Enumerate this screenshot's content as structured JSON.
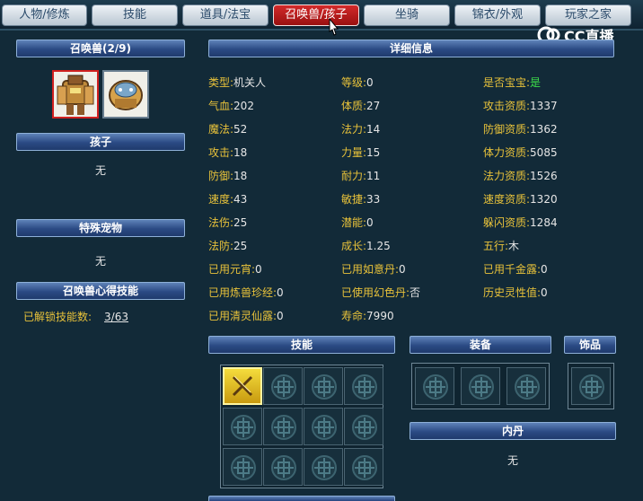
{
  "tabs": [
    {
      "label": "人物/修炼"
    },
    {
      "label": "技能"
    },
    {
      "label": "道具/法宝"
    },
    {
      "label": "召唤兽/孩子"
    },
    {
      "label": "坐骑"
    },
    {
      "label": "锦衣/外观"
    },
    {
      "label": "玩家之家"
    }
  ],
  "active_tab": "召唤兽/孩子",
  "logo": {
    "text": "CC直播"
  },
  "left": {
    "summon_header": "召唤兽(2/9)",
    "child_header": "孩子",
    "child_value": "无",
    "special_pet_header": "特殊宠物",
    "special_pet_value": "无",
    "heart_skill_header": "召唤兽心得技能",
    "unlocked_label": "已解锁技能数:",
    "unlocked_value": "3/63"
  },
  "detail": {
    "header": "详细信息",
    "rows": [
      [
        {
          "k": "类型:",
          "v": "机关人"
        },
        {
          "k": "等级:",
          "v": "0"
        },
        {
          "k": "是否宝宝:",
          "v": "是"
        }
      ],
      [
        {
          "k": "气血:",
          "v": "202"
        },
        {
          "k": "体质:",
          "v": "27"
        },
        {
          "k": "攻击资质:",
          "v": "1337"
        }
      ],
      [
        {
          "k": "魔法:",
          "v": "52"
        },
        {
          "k": "法力:",
          "v": "14"
        },
        {
          "k": "防御资质:",
          "v": "1362"
        }
      ],
      [
        {
          "k": "攻击:",
          "v": "18"
        },
        {
          "k": "力量:",
          "v": "15"
        },
        {
          "k": "体力资质:",
          "v": "5085"
        }
      ],
      [
        {
          "k": "防御:",
          "v": "18"
        },
        {
          "k": "耐力:",
          "v": "11"
        },
        {
          "k": "法力资质:",
          "v": "1526"
        }
      ],
      [
        {
          "k": "速度:",
          "v": "43"
        },
        {
          "k": "敏捷:",
          "v": "33"
        },
        {
          "k": "速度资质:",
          "v": "1320"
        }
      ],
      [
        {
          "k": "法伤:",
          "v": "25"
        },
        {
          "k": "潜能:",
          "v": "0"
        },
        {
          "k": "躲闪资质:",
          "v": "1284"
        }
      ],
      [
        {
          "k": "法防:",
          "v": "25"
        },
        {
          "k": "成长:",
          "v": "1.25"
        },
        {
          "k": "五行:",
          "v": "木"
        }
      ],
      [
        {
          "k": "已用元宵:",
          "v": "0"
        },
        {
          "k": "已用如意丹:",
          "v": "0"
        },
        {
          "k": "已用千金露:",
          "v": "0"
        }
      ],
      [
        {
          "k": "已用炼兽珍经:",
          "v": "0"
        },
        {
          "k": "已使用幻色丹:",
          "v": "否"
        },
        {
          "k": "历史灵性值:",
          "v": "0"
        }
      ],
      [
        {
          "k": "已用清灵仙露:",
          "v": "0"
        },
        {
          "k": "寿命:",
          "v": "7990"
        },
        {
          "k": "",
          "v": ""
        }
      ]
    ]
  },
  "skills_header": "技能",
  "equipment_header": "装备",
  "ornament_header": "饰品",
  "neidan_header": "内丹",
  "neidan_value": "无",
  "colors": {
    "label": "#e8c23a",
    "value": "#e6e6e6",
    "yes": "#3ee04a",
    "active_tab": "#c01818"
  }
}
